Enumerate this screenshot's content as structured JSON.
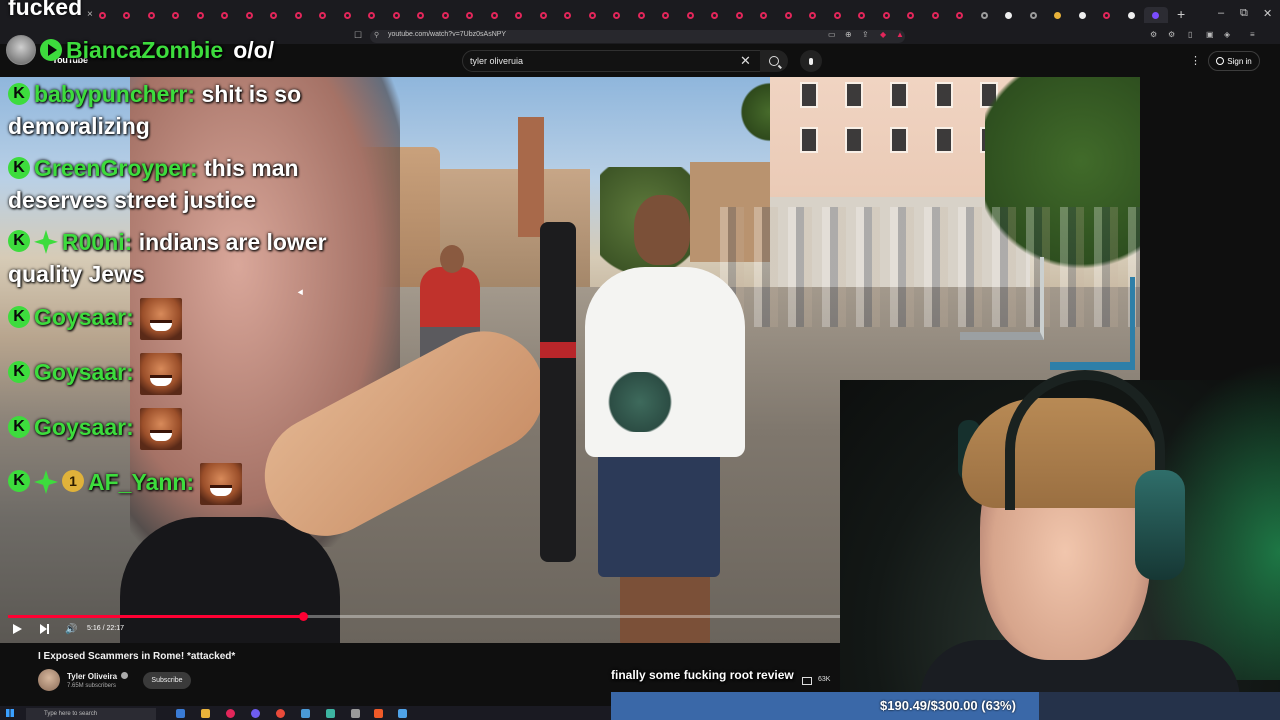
{
  "browser": {
    "url": "youtube.com/watch?v=7Ubz0sAsNPY",
    "new_tab_label": "+",
    "tab_close_label": "×",
    "window_controls": [
      "–",
      "⧉",
      "✕"
    ],
    "bookmark_icon": "bookmark-icon",
    "lock_icon": "lock-icon"
  },
  "youtube": {
    "logo": "YouTube",
    "search": {
      "value": "tyler oliveruia",
      "clear_icon": "close-icon"
    },
    "more_icon": "⋮",
    "sign_in_label": "Sign in"
  },
  "player": {
    "progress_fraction": 0.354,
    "time_display": "5:16 / 22:17",
    "volume_icon": "🔊"
  },
  "video_meta": {
    "title": "I Exposed Scammers in Rome! *attacked*",
    "channel_name": "Tyler Oliveira",
    "subscriber_count": "7.65M subscribers",
    "subscribe_label": "Subscribe"
  },
  "taskbar": {
    "search_placeholder": "Type here to search"
  },
  "overlay": {
    "top_title": "fucked",
    "chat": [
      {
        "user": "BiancaZombie",
        "text": "o/o/"
      },
      {
        "user": "babypuncherr",
        "text": "shit is so demoralizing"
      },
      {
        "user": "GreenGroyper",
        "text": "this man deserves street justice"
      },
      {
        "user": "R00ni",
        "text": "indians are lower quality Jews"
      },
      {
        "user": "Goysaar",
        "text": ""
      },
      {
        "user": "Goysaar",
        "text": ""
      },
      {
        "user": "Goysaar",
        "text": ""
      },
      {
        "user": "AF_Yann",
        "sub_months": "1",
        "text": ""
      }
    ],
    "caption": "finally some fucking root review",
    "viewer_count": "63K",
    "goal": {
      "text": "$190.49/$300.00 (63%)",
      "fraction": 0.635
    }
  },
  "colors": {
    "chat_username": "#3ddc3d",
    "youtube_progress": "#ff0033",
    "goal_fill": "#3a68a8",
    "goal_track": "#25324a"
  }
}
